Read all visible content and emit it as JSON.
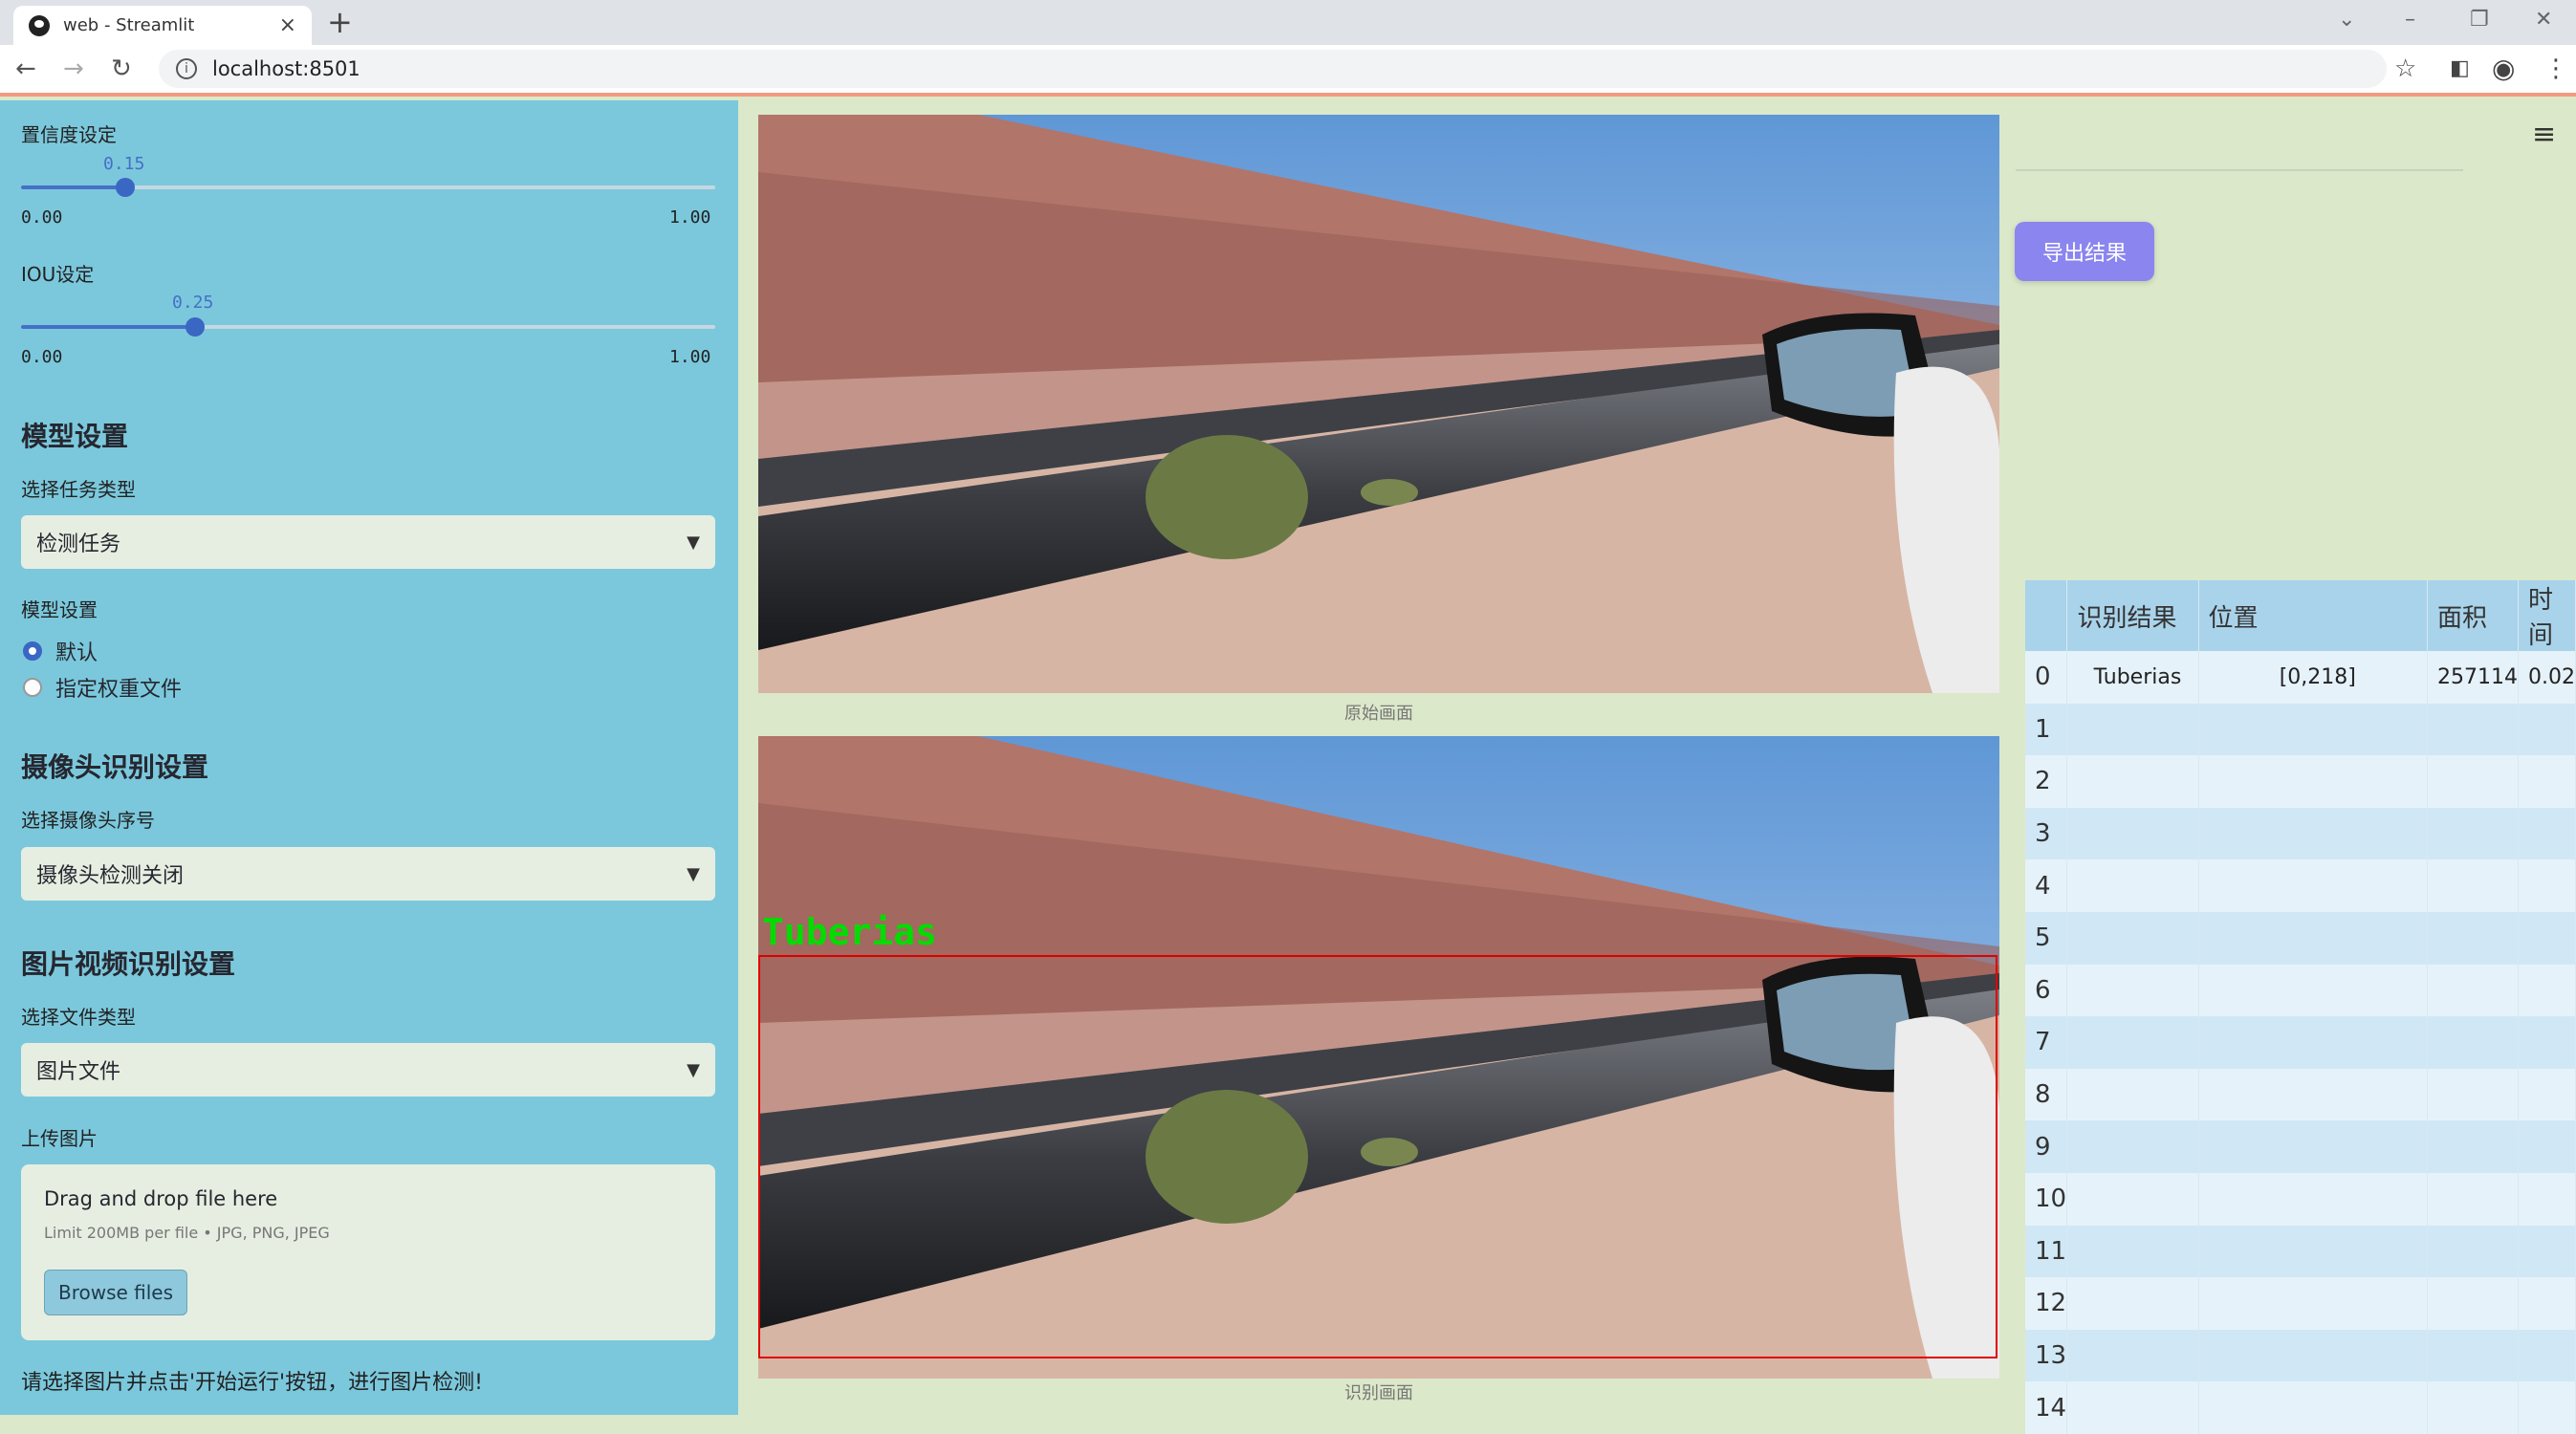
{
  "browser": {
    "tab_title": "web - Streamlit",
    "url": "localhost:8501"
  },
  "sidebar": {
    "confidence": {
      "label": "置信度设定",
      "value": "0.15",
      "min": "0.00",
      "max": "1.00",
      "fraction": 0.15
    },
    "iou": {
      "label": "IOU设定",
      "value": "0.25",
      "min": "0.00",
      "max": "1.00",
      "fraction": 0.25
    },
    "model_section": "模型设置",
    "task_label": "选择任务类型",
    "task_value": "检测任务",
    "model_label": "模型设置",
    "model_options": [
      "默认",
      "指定权重文件"
    ],
    "camera_section": "摄像头识别设置",
    "camera_label": "选择摄像头序号",
    "camera_value": "摄像头检测关闭",
    "media_section": "图片视频识别设置",
    "file_type_label": "选择文件类型",
    "file_type_value": "图片文件",
    "upload_label": "上传图片",
    "upload_title": "Drag and drop file here",
    "upload_limit": "Limit 200MB per file • JPG, PNG, JPEG",
    "browse_button": "Browse files",
    "hint": "请选择图片并点击'开始运行'按钮，进行图片检测!"
  },
  "main": {
    "original_caption": "原始画面",
    "result_caption": "识别画面",
    "detection_label": "Tuberias",
    "export_button": "导出结果"
  },
  "results_table": {
    "headers": [
      "",
      "识别结果",
      "位置",
      "面积",
      "时间"
    ],
    "rows": [
      [
        "0",
        "Tuberias",
        "[0,218]",
        "257114",
        "0.02"
      ],
      [
        "1",
        "",
        "",
        "",
        ""
      ],
      [
        "2",
        "",
        "",
        "",
        ""
      ],
      [
        "3",
        "",
        "",
        "",
        ""
      ],
      [
        "4",
        "",
        "",
        "",
        ""
      ],
      [
        "5",
        "",
        "",
        "",
        ""
      ],
      [
        "6",
        "",
        "",
        "",
        ""
      ],
      [
        "7",
        "",
        "",
        "",
        ""
      ],
      [
        "8",
        "",
        "",
        "",
        ""
      ],
      [
        "9",
        "",
        "",
        "",
        ""
      ],
      [
        "10",
        "",
        "",
        "",
        ""
      ],
      [
        "11",
        "",
        "",
        "",
        ""
      ],
      [
        "12",
        "",
        "",
        "",
        ""
      ],
      [
        "13",
        "",
        "",
        "",
        ""
      ],
      [
        "14",
        "",
        "",
        "",
        ""
      ]
    ]
  }
}
